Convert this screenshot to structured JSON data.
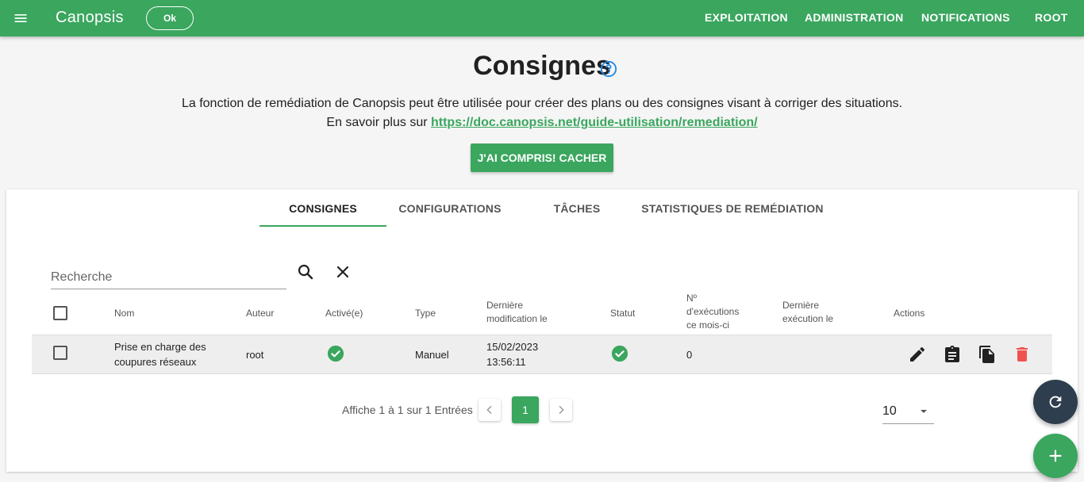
{
  "header": {
    "app_title": "Canopsis",
    "ok_label": "Ok",
    "nav": [
      "EXPLOITATION",
      "ADMINISTRATION",
      "NOTIFICATIONS",
      "ROOT"
    ]
  },
  "page": {
    "title": "Consignes",
    "description": "La fonction de remédiation de Canopsis peut être utilisée pour créer des plans ou des consignes visant à corriger des situations.",
    "learn_more_prefix": "En savoir plus sur ",
    "learn_more_link": "https://doc.canopsis.net/guide-utilisation/remediation/",
    "got_it_button": "J'AI COMPRIS! CACHER"
  },
  "tabs": [
    {
      "label": "CONSIGNES",
      "active": true
    },
    {
      "label": "CONFIGURATIONS",
      "active": false
    },
    {
      "label": "TÂCHES",
      "active": false
    },
    {
      "label": "STATISTIQUES DE REMÉDIATION",
      "active": false
    }
  ],
  "search": {
    "placeholder": "Recherche",
    "value": ""
  },
  "table": {
    "headers": {
      "name": "Nom",
      "author": "Auteur",
      "enabled": "Activé(e)",
      "type": "Type",
      "last_modified_1": "Dernière",
      "last_modified_2": "modification le",
      "status": "Statut",
      "executions_1": "Nº",
      "executions_2": "d'exécutions",
      "executions_3": "ce mois-ci",
      "last_exec_1": "Dernière",
      "last_exec_2": "exécution le",
      "actions": "Actions"
    },
    "rows": [
      {
        "name_line1": "Prise en charge des",
        "name_line2": "coupures réseaux",
        "author": "root",
        "enabled": true,
        "type": "Manuel",
        "modified_date": "15/02/2023",
        "modified_time": "13:56:11",
        "status": "ok",
        "executions": "0",
        "last_execution": ""
      }
    ]
  },
  "pagination": {
    "summary": "Affiche 1 à 1 sur 1 Entrées",
    "current_page": "1",
    "per_page": "10"
  },
  "colors": {
    "brand": "#3aa65e",
    "delete": "#ef5350",
    "fab_dark": "#2e3e4e"
  },
  "icons": {
    "menu": "menu-icon",
    "help": "help-circle-icon",
    "search": "search-icon",
    "clear": "close-icon",
    "check": "check-circle-icon",
    "edit": "pencil-icon",
    "assign": "clipboard-icon",
    "duplicate": "copy-icon",
    "delete": "trash-icon",
    "refresh": "refresh-icon",
    "add": "plus-icon"
  }
}
